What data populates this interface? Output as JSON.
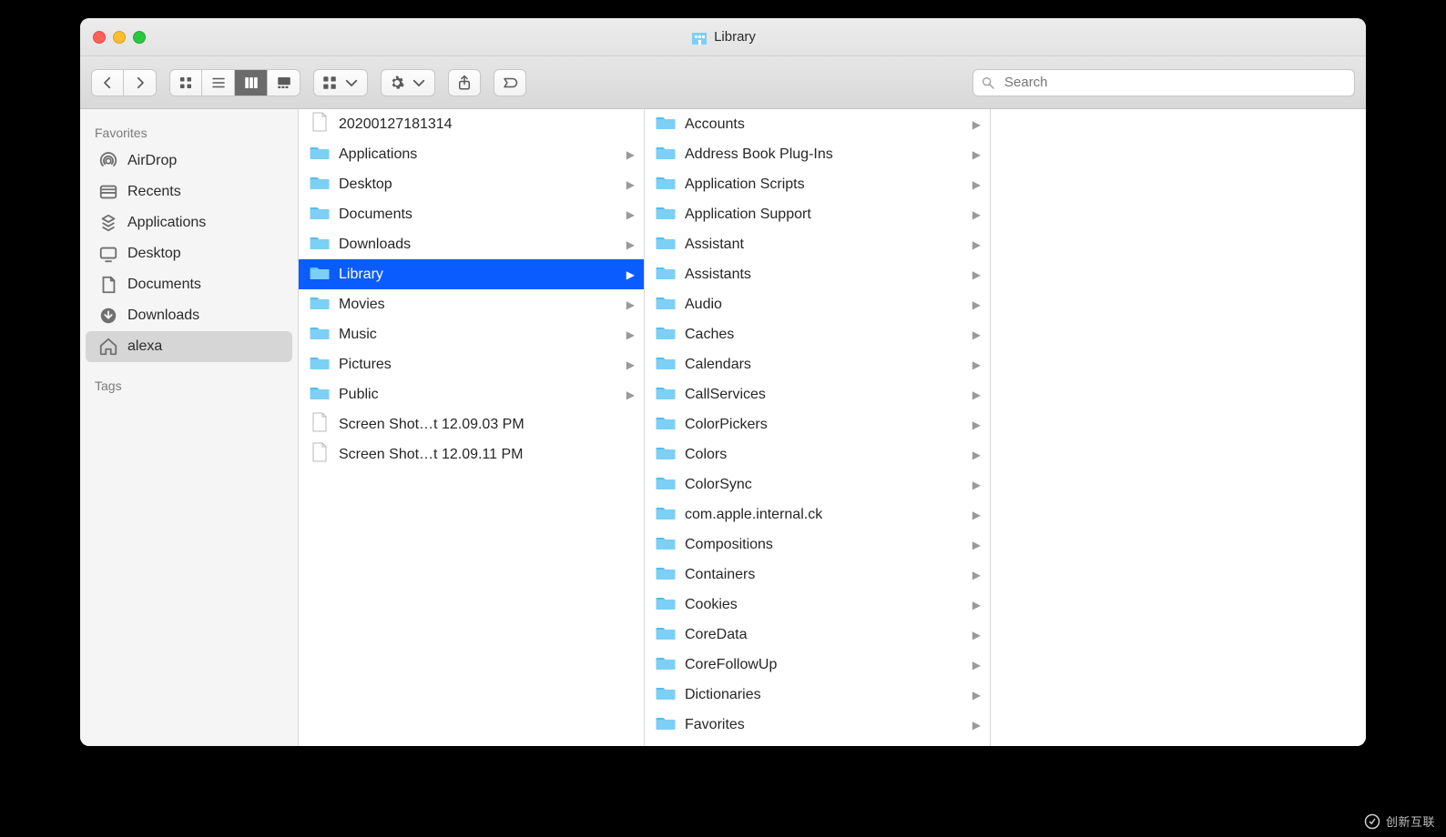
{
  "window": {
    "title": "Library"
  },
  "toolbar": {
    "nav_back_label": "Back",
    "nav_fwd_label": "Forward",
    "search_placeholder": "Search",
    "views": [
      "icon",
      "list",
      "column",
      "gallery"
    ],
    "active_view": "column"
  },
  "sidebar": {
    "favorites_header": "Favorites",
    "items": [
      {
        "icon": "airdrop",
        "label": "AirDrop"
      },
      {
        "icon": "recents",
        "label": "Recents"
      },
      {
        "icon": "apps",
        "label": "Applications"
      },
      {
        "icon": "desktop",
        "label": "Desktop"
      },
      {
        "icon": "docs",
        "label": "Documents"
      },
      {
        "icon": "downloads",
        "label": "Downloads"
      },
      {
        "icon": "home",
        "label": "alexa",
        "selected": true
      }
    ],
    "tags_header": "Tags"
  },
  "column1": [
    {
      "type": "file",
      "name": "20200127181314"
    },
    {
      "type": "folder",
      "name": "Applications",
      "hasChildren": true
    },
    {
      "type": "folder",
      "name": "Desktop",
      "hasChildren": true
    },
    {
      "type": "folder",
      "name": "Documents",
      "hasChildren": true
    },
    {
      "type": "folder",
      "name": "Downloads",
      "hasChildren": true
    },
    {
      "type": "folder",
      "name": "Library",
      "hasChildren": true,
      "selected": true
    },
    {
      "type": "folder",
      "name": "Movies",
      "hasChildren": true
    },
    {
      "type": "folder",
      "name": "Music",
      "hasChildren": true
    },
    {
      "type": "folder",
      "name": "Pictures",
      "hasChildren": true
    },
    {
      "type": "folder",
      "name": "Public",
      "hasChildren": true
    },
    {
      "type": "file",
      "name": "Screen Shot…t 12.09.03 PM"
    },
    {
      "type": "file",
      "name": "Screen Shot…t 12.09.11 PM"
    }
  ],
  "column2": [
    {
      "type": "folder",
      "name": "Accounts",
      "hasChildren": true
    },
    {
      "type": "folder",
      "name": "Address Book Plug-Ins",
      "hasChildren": true
    },
    {
      "type": "folder",
      "name": "Application Scripts",
      "hasChildren": true
    },
    {
      "type": "folder",
      "name": "Application Support",
      "hasChildren": true
    },
    {
      "type": "folder",
      "name": "Assistant",
      "hasChildren": true
    },
    {
      "type": "folder",
      "name": "Assistants",
      "hasChildren": true
    },
    {
      "type": "folder",
      "name": "Audio",
      "hasChildren": true
    },
    {
      "type": "folder",
      "name": "Caches",
      "hasChildren": true
    },
    {
      "type": "folder",
      "name": "Calendars",
      "hasChildren": true
    },
    {
      "type": "folder",
      "name": "CallServices",
      "hasChildren": true
    },
    {
      "type": "folder",
      "name": "ColorPickers",
      "hasChildren": true
    },
    {
      "type": "folder",
      "name": "Colors",
      "hasChildren": true
    },
    {
      "type": "folder",
      "name": "ColorSync",
      "hasChildren": true
    },
    {
      "type": "folder",
      "name": "com.apple.internal.ck",
      "hasChildren": true
    },
    {
      "type": "folder",
      "name": "Compositions",
      "hasChildren": true
    },
    {
      "type": "folder",
      "name": "Containers",
      "hasChildren": true
    },
    {
      "type": "folder",
      "name": "Cookies",
      "hasChildren": true
    },
    {
      "type": "folder",
      "name": "CoreData",
      "hasChildren": true
    },
    {
      "type": "folder",
      "name": "CoreFollowUp",
      "hasChildren": true
    },
    {
      "type": "folder",
      "name": "Dictionaries",
      "hasChildren": true
    },
    {
      "type": "folder",
      "name": "Favorites",
      "hasChildren": true
    }
  ],
  "watermark": "创新互联"
}
